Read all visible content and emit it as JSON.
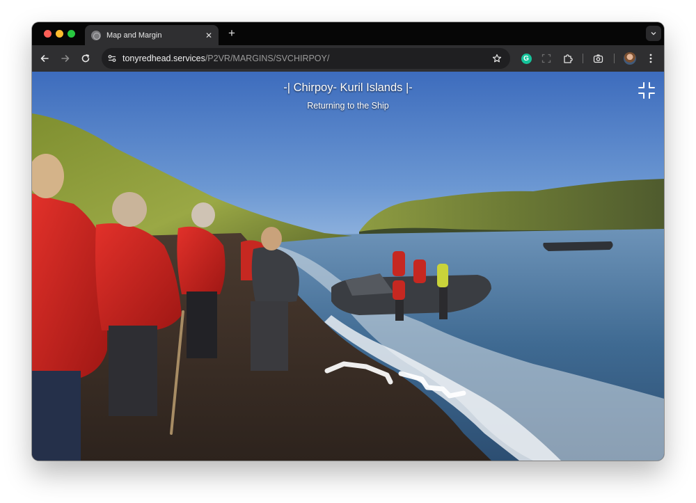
{
  "browser": {
    "tab": {
      "title": "Map and Margin",
      "favicon": "globe-icon",
      "close_icon": "close-icon"
    },
    "new_tab_icon": "plus-icon",
    "tab_search_icon": "chevron-down-icon",
    "toolbar": {
      "back_icon": "back-arrow-icon",
      "forward_icon": "forward-arrow-icon",
      "reload_icon": "reload-icon",
      "site_info_icon": "tune-icon",
      "url_host": "tonyredhead.services",
      "url_path": "/P2VR/MARGINS/SVCHIRPOY/",
      "bookmark_icon": "star-icon",
      "extensions": [
        "grammarly-icon",
        "screenshot-icon",
        "puzzle-icon",
        "camera-icon"
      ],
      "grammarly_letter": "G",
      "profile_icon": "avatar",
      "menu_icon": "kebab-menu-icon"
    }
  },
  "pano": {
    "title": "-| Chirpoy- Kuril Islands |-",
    "subtitle": "Returning to the Ship",
    "fullscreen_icon": "exit-fullscreen-icon",
    "hotspot_icon": "chevron-hotspot-icon"
  },
  "colors": {
    "sky_top": "#3d6cbd",
    "sky_bottom": "#8cb4df",
    "hill": "#8c9c3a",
    "sea": "#3f6a92",
    "sand": "#3a2e26",
    "jacket_red": "#c9211e"
  }
}
